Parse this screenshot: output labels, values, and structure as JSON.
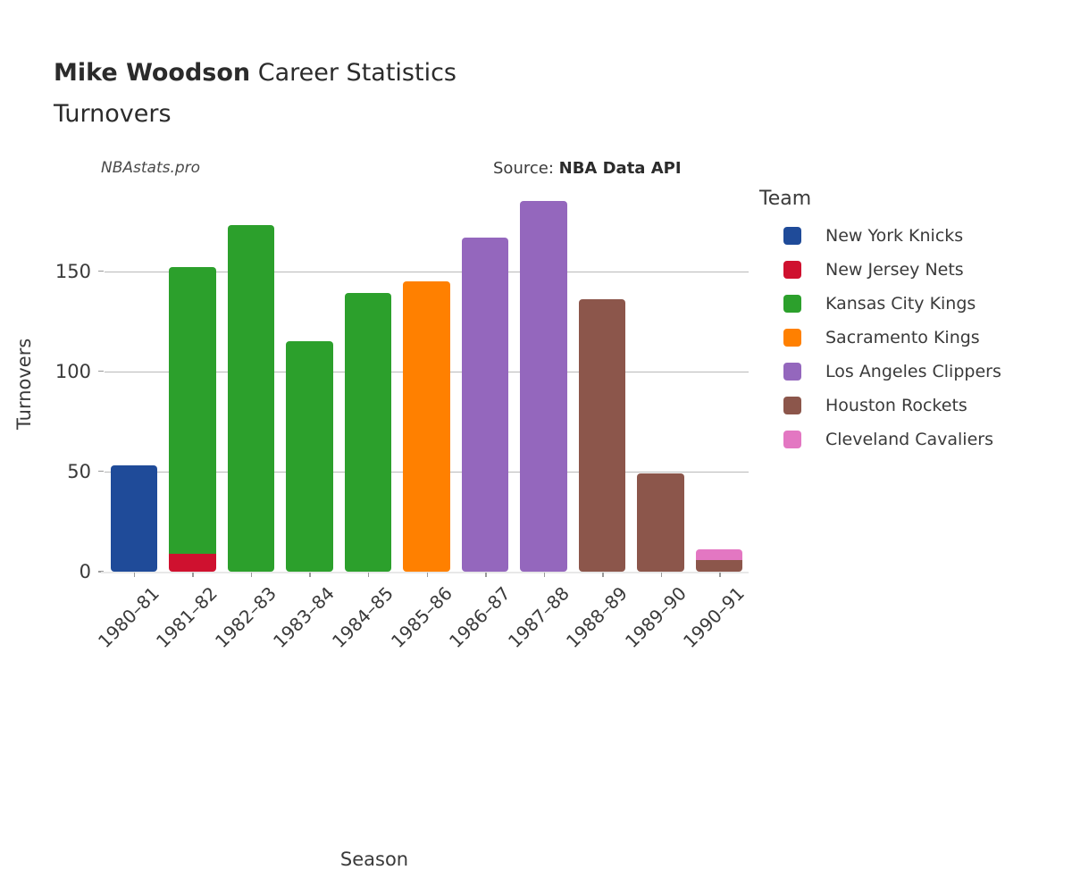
{
  "header": {
    "player": "Mike Woodson",
    "title_rest": "Career Statistics",
    "subtitle": "Turnovers",
    "watermark": "NBAstats.pro",
    "source_prefix": "Source:",
    "source_name": "NBA Data API"
  },
  "legend": {
    "title": "Team",
    "items": [
      {
        "label": "New York Knicks",
        "color": "#1f4b99"
      },
      {
        "label": "New Jersey Nets",
        "color": "#cf112f"
      },
      {
        "label": "Kansas City Kings",
        "color": "#2ca02c"
      },
      {
        "label": "Sacramento Kings",
        "color": "#ff8000"
      },
      {
        "label": "Los Angeles Clippers",
        "color": "#9467bd"
      },
      {
        "label": "Houston Rockets",
        "color": "#8c564b"
      },
      {
        "label": "Cleveland Cavaliers",
        "color": "#e377c2"
      }
    ]
  },
  "chart_data": {
    "type": "bar",
    "title": "Mike Woodson Career Statistics — Turnovers",
    "xlabel": "Season",
    "ylabel": "Turnovers",
    "ylim": [
      0,
      194
    ],
    "yticks": [
      0,
      50,
      100,
      150
    ],
    "ytick_labels": [
      "0",
      "50",
      "100",
      "150"
    ],
    "grid": "horizontal",
    "legend_position": "right",
    "stacked": true,
    "categories": [
      "1980–81",
      "1981–82",
      "1982–83",
      "1983–84",
      "1984–85",
      "1985–86",
      "1986–87",
      "1987–88",
      "1988–89",
      "1989–90",
      "1990–91"
    ],
    "series": [
      {
        "name": "New York Knicks",
        "color": "#1f4b99",
        "values": [
          53,
          0,
          0,
          0,
          0,
          0,
          0,
          0,
          0,
          0,
          0
        ]
      },
      {
        "name": "New Jersey Nets",
        "color": "#cf112f",
        "values": [
          0,
          9,
          0,
          0,
          0,
          0,
          0,
          0,
          0,
          0,
          0
        ]
      },
      {
        "name": "Kansas City Kings",
        "color": "#2ca02c",
        "values": [
          0,
          143,
          173,
          115,
          139,
          0,
          0,
          0,
          0,
          0,
          0
        ]
      },
      {
        "name": "Sacramento Kings",
        "color": "#ff8000",
        "values": [
          0,
          0,
          0,
          0,
          0,
          145,
          0,
          0,
          0,
          0,
          0
        ]
      },
      {
        "name": "Los Angeles Clippers",
        "color": "#9467bd",
        "values": [
          0,
          0,
          0,
          0,
          0,
          0,
          167,
          185,
          0,
          0,
          0
        ]
      },
      {
        "name": "Houston Rockets",
        "color": "#8c564b",
        "values": [
          0,
          0,
          0,
          0,
          0,
          0,
          0,
          0,
          136,
          49,
          6
        ]
      },
      {
        "name": "Cleveland Cavaliers",
        "color": "#e377c2",
        "values": [
          0,
          0,
          0,
          0,
          0,
          0,
          0,
          0,
          0,
          0,
          5
        ]
      }
    ],
    "totals": [
      53,
      152,
      173,
      115,
      139,
      145,
      167,
      185,
      136,
      49,
      11
    ]
  }
}
